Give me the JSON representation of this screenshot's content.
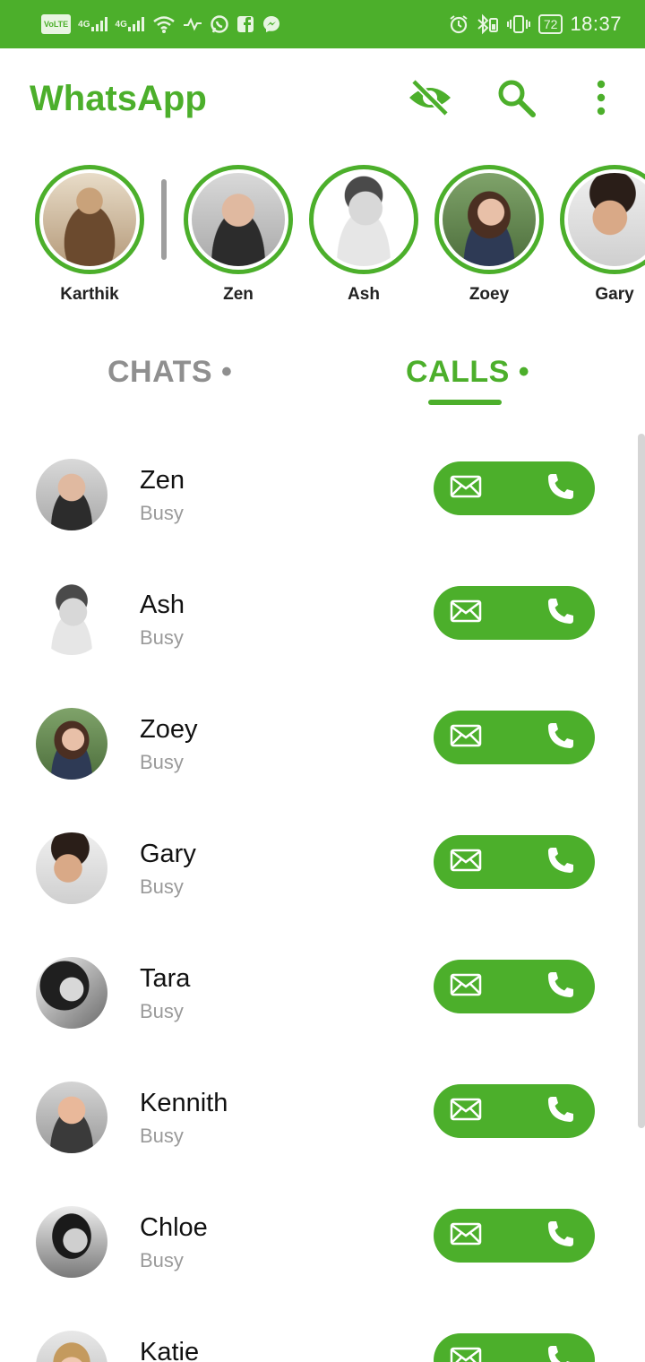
{
  "status_bar": {
    "left_icons": [
      "volte-icon",
      "4g-signal-icon",
      "4g-signal-icon",
      "wifi-icon",
      "data-activity-icon",
      "whatsapp-notification-icon",
      "facebook-notification-icon",
      "messenger-notification-icon"
    ],
    "volte_label": "VoLTE",
    "network_label_1": "4G",
    "network_label_2": "4G",
    "right_icons": [
      "alarm-icon",
      "bluetooth-icon",
      "vibrate-icon",
      "battery-icon"
    ],
    "battery": "72",
    "time": "18:37"
  },
  "header": {
    "title": "WhatsApp",
    "actions": [
      "hide-eye-icon",
      "search-icon",
      "more-vert-icon"
    ]
  },
  "stories": [
    {
      "name": "Karthik"
    },
    {
      "name": "Zen"
    },
    {
      "name": "Ash"
    },
    {
      "name": "Zoey"
    },
    {
      "name": "Gary"
    }
  ],
  "tabs": [
    {
      "label": "CHATS •",
      "active": false
    },
    {
      "label": "CALLS •",
      "active": true
    }
  ],
  "calls": [
    {
      "name": "Zen",
      "status": "Busy"
    },
    {
      "name": "Ash",
      "status": "Busy"
    },
    {
      "name": "Zoey",
      "status": "Busy"
    },
    {
      "name": "Gary",
      "status": "Busy"
    },
    {
      "name": "Tara",
      "status": "Busy"
    },
    {
      "name": "Kennith",
      "status": "Busy"
    },
    {
      "name": "Chloe",
      "status": "Busy"
    },
    {
      "name": "Katie",
      "status": ""
    }
  ],
  "colors": {
    "accent": "#4caf2b",
    "inactive_tab": "#8f8f8f",
    "status_text": "#9a9a9a"
  }
}
